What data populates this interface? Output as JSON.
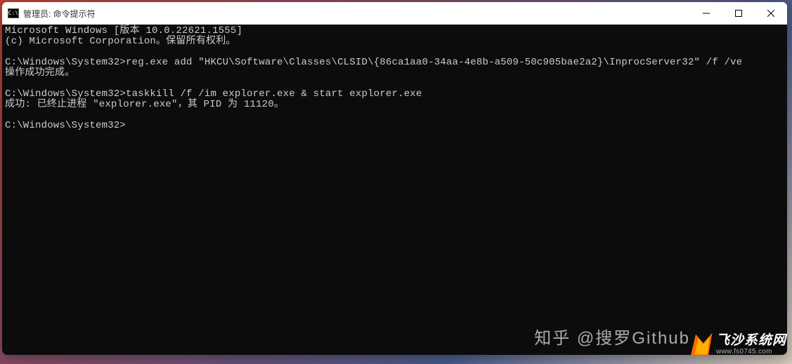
{
  "titlebar": {
    "icon_glyph": "C:\\",
    "title": "管理员: 命令提示符"
  },
  "terminal": {
    "lines": [
      "Microsoft Windows [版本 10.0.22621.1555]",
      "(c) Microsoft Corporation。保留所有权利。",
      "",
      "C:\\Windows\\System32>reg.exe add \"HKCU\\Software\\Classes\\CLSID\\{86ca1aa0-34aa-4e8b-a509-50c905bae2a2}\\InprocServer32\" /f /ve",
      "操作成功完成。",
      "",
      "C:\\Windows\\System32>taskkill /f /im explorer.exe & start explorer.exe",
      "成功: 已终止进程 \"explorer.exe\"，其 PID 为 11120。",
      "",
      "C:\\Windows\\System32>"
    ]
  },
  "watermarks": {
    "zhihu": "知乎 @搜罗Github",
    "feisha_brand": "飞沙系统网",
    "feisha_url": "www.fs0745.com"
  }
}
